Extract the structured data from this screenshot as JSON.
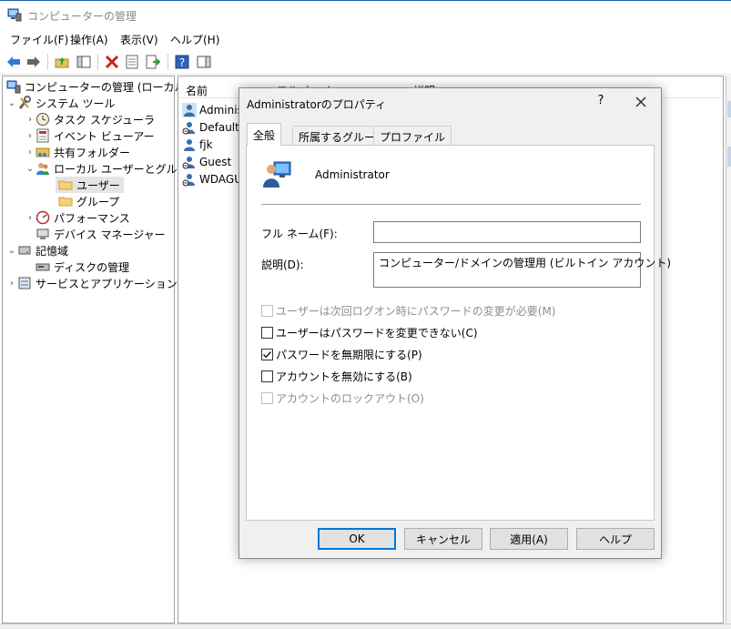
{
  "window": {
    "title": "コンピューターの管理"
  },
  "menu": [
    "ファイル(F)",
    "操作(A)",
    "表示(V)",
    "ヘルプ(H)"
  ],
  "toolbar": {
    "buttons": [
      "back-arrow-icon",
      "forward-arrow-icon",
      "up-folder-icon",
      "show-hide-tree-icon",
      "delete-icon",
      "properties-icon",
      "export-list-icon",
      "help-icon",
      "show-hide-action-pane-icon"
    ]
  },
  "tree": {
    "root": "コンピューターの管理 (ローカル)",
    "system_tools": "システム ツール",
    "task_scheduler": "タスク スケジューラ",
    "event_viewer": "イベント ビューアー",
    "shared_folders": "共有フォルダー",
    "local_users_groups": "ローカル ユーザーとグループ",
    "users": "ユーザー",
    "groups": "グループ",
    "performance": "パフォーマンス",
    "device_manager": "デバイス マネージャー",
    "storage": "記憶域",
    "disk_management": "ディスクの管理",
    "services_apps": "サービスとアプリケーション"
  },
  "list": {
    "columns": [
      "名前",
      "フル ネーム",
      "説明"
    ],
    "rows": [
      "Adminis",
      "DefaultA",
      "fjk",
      "Guest",
      "WDAGU"
    ]
  },
  "dialog": {
    "title": "Administratorのプロパティ",
    "help_glyph": "?",
    "tabs": [
      "全般",
      "所属するグループ",
      "プロファイル"
    ],
    "username": "Administrator",
    "fullname_label": "フル ネーム(F):",
    "fullname_value": "",
    "description_label": "説明(D):",
    "description_value": "コンピューター/ドメインの管理用 (ビルトイン アカウント)",
    "options": [
      {
        "label": "ユーザーは次回ログオン時にパスワードの変更が必要(M)",
        "checked": false,
        "enabled": false
      },
      {
        "label": "ユーザーはパスワードを変更できない(C)",
        "checked": false,
        "enabled": true
      },
      {
        "label": "パスワードを無期限にする(P)",
        "checked": true,
        "enabled": true
      },
      {
        "label": "アカウントを無効にする(B)",
        "checked": false,
        "enabled": true
      },
      {
        "label": "アカウントのロックアウト(O)",
        "checked": false,
        "enabled": false
      }
    ],
    "buttons": {
      "ok": "OK",
      "cancel": "キャンセル",
      "apply": "適用(A)",
      "help": "ヘルプ"
    }
  },
  "colors": {
    "accent": "#0078d7",
    "window_border": "#1e5ea8",
    "dialog_bg": "#f0f0f0"
  }
}
